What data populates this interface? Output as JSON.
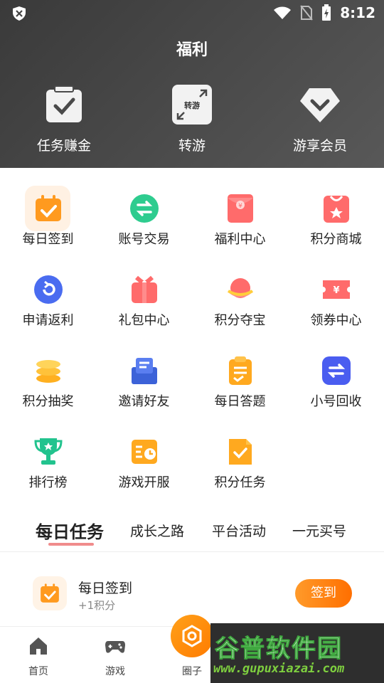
{
  "status_bar": {
    "time": "8:12"
  },
  "page": {
    "title": "福利"
  },
  "top_features": [
    {
      "label": "任务赚金",
      "icon": "checkbox-icon"
    },
    {
      "label": "转游",
      "icon": "transfer-game-icon",
      "icon_text": "转游"
    },
    {
      "label": "游享会员",
      "icon": "vip-diamond-icon"
    }
  ],
  "grid_items": [
    {
      "label": "每日签到",
      "icon": "calendar-check-icon"
    },
    {
      "label": "账号交易",
      "icon": "exchange-icon"
    },
    {
      "label": "福利中心",
      "icon": "red-envelope-icon"
    },
    {
      "label": "积分商城",
      "icon": "shop-bag-icon"
    },
    {
      "label": "申请返利",
      "icon": "refund-icon"
    },
    {
      "label": "礼包中心",
      "icon": "gift-icon"
    },
    {
      "label": "积分夺宝",
      "icon": "treasure-icon"
    },
    {
      "label": "领券中心",
      "icon": "coupon-icon"
    },
    {
      "label": "积分抽奖",
      "icon": "coin-stack-icon"
    },
    {
      "label": "邀请好友",
      "icon": "invite-mail-icon"
    },
    {
      "label": "每日答题",
      "icon": "clipboard-answer-icon"
    },
    {
      "label": "小号回收",
      "icon": "recycle-icon"
    },
    {
      "label": "排行榜",
      "icon": "trophy-icon"
    },
    {
      "label": "游戏开服",
      "icon": "server-clock-icon"
    },
    {
      "label": "积分任务",
      "icon": "task-doc-icon"
    }
  ],
  "tabs": [
    {
      "label": "每日任务",
      "active": true
    },
    {
      "label": "成长之路",
      "active": false
    },
    {
      "label": "平台活动",
      "active": false
    },
    {
      "label": "一元买号",
      "active": false
    }
  ],
  "task": {
    "title": "每日签到",
    "subtitle": "+1积分",
    "button": "签到"
  },
  "bottom_nav": [
    {
      "label": "首页",
      "icon": "home-icon"
    },
    {
      "label": "游戏",
      "icon": "gamepad-icon"
    },
    {
      "label": "圈子",
      "icon": "circle-icon"
    }
  ],
  "watermark": {
    "title": "谷普软件园",
    "url": "www.gupuxiazai.com"
  },
  "colors": {
    "accent": "#ff7b00",
    "header_bg": "#4a4a4a",
    "tab_underline": "#f08c8c"
  }
}
